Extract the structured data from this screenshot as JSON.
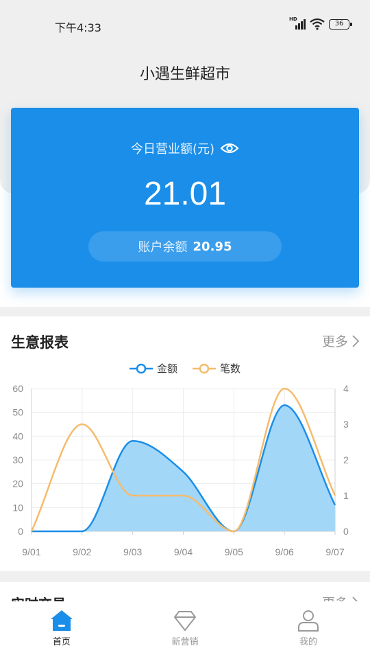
{
  "status": {
    "time": "下午4:33",
    "network": "HD",
    "battery": "36"
  },
  "header": {
    "title": "小遇生鲜超市"
  },
  "revenue_card": {
    "label": "今日营业额(元)",
    "amount": "21.01",
    "balance_label": "账户余额",
    "balance_value": "20.95"
  },
  "report": {
    "title": "生意报表",
    "more": "更多"
  },
  "chart_data": {
    "type": "line",
    "categories": [
      "9/01",
      "9/02",
      "9/03",
      "9/04",
      "9/05",
      "9/06",
      "9/07"
    ],
    "y_left": {
      "ticks": [
        "0",
        "10",
        "20",
        "30",
        "40",
        "50",
        "60"
      ],
      "range": [
        0,
        60
      ]
    },
    "y_right": {
      "ticks": [
        "0",
        "1",
        "2",
        "3",
        "4"
      ],
      "range": [
        0,
        4
      ]
    },
    "grid": true,
    "legend_position": "top-center",
    "series": [
      {
        "name": "金额",
        "axis": "left",
        "color": "#1a8ee9",
        "area": true,
        "values": [
          0,
          0,
          38,
          25,
          0,
          53,
          11
        ]
      },
      {
        "name": "笔数",
        "axis": "right",
        "color": "#f5bb6b",
        "area": false,
        "values": [
          0,
          3,
          1,
          1,
          0,
          4,
          1
        ]
      }
    ]
  },
  "realtime": {
    "title": "实时交易",
    "more": "更多"
  },
  "tabbar": {
    "items": [
      {
        "label": "首页",
        "icon": "home-icon",
        "active": true
      },
      {
        "label": "新营销",
        "icon": "diamond-icon",
        "active": false
      },
      {
        "label": "我的",
        "icon": "user-icon",
        "active": false
      }
    ]
  }
}
